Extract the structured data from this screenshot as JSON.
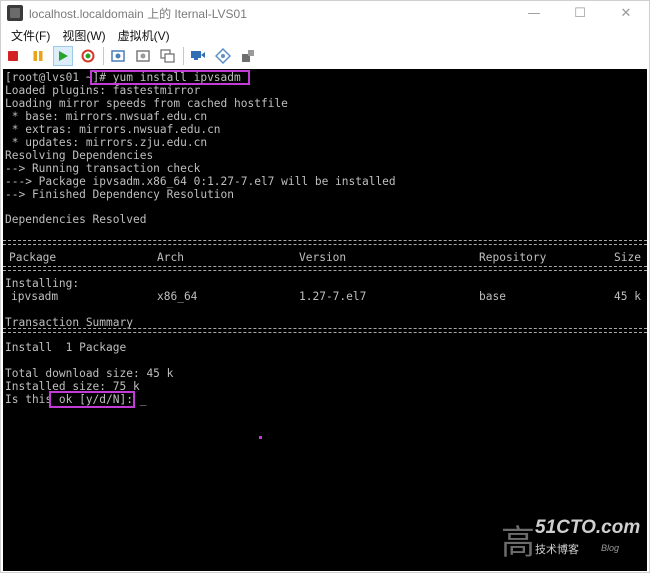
{
  "window": {
    "title": "localhost.localdomain 上的 Iternal-LVS01",
    "controls": {
      "minimize": "—",
      "maximize": "☐",
      "close": "✕"
    }
  },
  "menu": [
    "文件(F)",
    "视图(W)",
    "虚拟机(V)"
  ],
  "toolbar": {
    "buttons": [
      {
        "name": "stop-icon",
        "color": "#d32020"
      },
      {
        "name": "pause-icon",
        "color": "#e8a317"
      },
      {
        "name": "play-icon",
        "color": "#2aa12a"
      },
      {
        "name": "reset-icon",
        "color": "#d33a2a"
      },
      {
        "name": "snapshot-icon",
        "color": "#4a7fb8"
      },
      {
        "name": "snapshot-revert-icon",
        "color": "#7a7a7a"
      },
      {
        "name": "snapshot-manager-icon",
        "color": "#6a6a6a"
      },
      {
        "name": "network-icon",
        "color": "#2f6fb3"
      },
      {
        "name": "usb-icon",
        "color": "#5a8fc7"
      },
      {
        "name": "settings-icon",
        "color": "#6d6d6d"
      }
    ]
  },
  "console": {
    "lines": [
      "[root@lvs01 ~]# yum install ipvsadm",
      "Loaded plugins: fastestmirror",
      "Loading mirror speeds from cached hostfile",
      " * base: mirrors.nwsuaf.edu.cn",
      " * extras: mirrors.nwsuaf.edu.cn",
      " * updates: mirrors.zju.edu.cn",
      "Resolving Dependencies",
      "--> Running transaction check",
      "---> Package ipvsadm.x86_64 0:1.27-7.el7 will be installed",
      "--> Finished Dependency Resolution",
      "",
      "Dependencies Resolved"
    ],
    "table": {
      "headers": [
        "Package",
        "Arch",
        "Version",
        "Repository",
        "Size"
      ],
      "section": "Installing:",
      "rows": [
        [
          "ipvsadm",
          "x86_64",
          "1.27-7.el7",
          "base",
          "45 k"
        ]
      ]
    },
    "summary_title": "Transaction Summary",
    "summary_lines": [
      "Install  1 Package",
      "",
      "Total download size: 45 k",
      "Installed size: 75 k",
      "Is this ok [y/d/N]: _"
    ]
  },
  "watermark": {
    "big_char": "高",
    "site": "51CTO.com",
    "sub": "技术博客",
    "blog": "Blog"
  }
}
